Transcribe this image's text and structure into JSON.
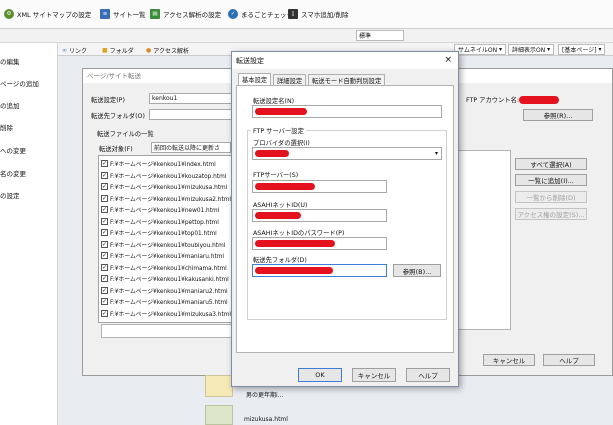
{
  "toolbar": {
    "items": [
      {
        "label": "XML サイトマップの設定",
        "icon": "gear-icon",
        "color": "#5a8f2c"
      },
      {
        "label": "サイト一覧",
        "icon": "list-icon",
        "color": "#3a6db5"
      },
      {
        "label": "アクセス解析の設定",
        "icon": "chart-icon",
        "color": "#3b8d3b"
      },
      {
        "label": "まるごとチェック",
        "icon": "check-icon",
        "color": "#2a6fb5"
      },
      {
        "label": "スマホ追加/削除",
        "icon": "phone-icon",
        "color": "#333333"
      }
    ],
    "mode_select": "標準"
  },
  "sidebar": {
    "items": [
      "の編集",
      "ページの追加",
      "の追加",
      "削除",
      "への変更",
      "名の変更",
      "の設定"
    ]
  },
  "tabs": {
    "items": [
      "リンク",
      "フォルダ",
      "アクセス解析"
    ],
    "thumbnail": "サムネイルON",
    "detail": "詳細表示ON",
    "basic": "[基本ページ]"
  },
  "background_dialog": {
    "title": "ページ/サイト転送",
    "transfer_setting_label": "転送設定(P)",
    "transfer_setting_value": "kenkou1",
    "transfer_folder_label": "転送先フォルダ(O)",
    "ftp_account_label": "FTP アカウント名:",
    "ref_button": "参照(R)...",
    "file_list_label": "転送ファイルの一覧",
    "transfer_target_label": "転送対象(F)",
    "transfer_target_value": "前回の転送以降に更新さ",
    "files": [
      "F:¥ホームページ¥kenkou1¥index.html",
      "F:¥ホームページ¥kenkou1¥kouzatop.html",
      "F:¥ホームページ¥kenkou1¥mizukusa.html",
      "F:¥ホームページ¥kenkou1¥mizukusa2.html",
      "F:¥ホームページ¥kenkou1¥new01.html",
      "F:¥ホームページ¥kenkou1¥pettop.html",
      "F:¥ホームページ¥kenkou1¥top01.html",
      "F:¥ホームページ¥kenkou1¥toubiyou.html",
      "F:¥ホームページ¥kenkou1¥maniaru.html",
      "F:¥ホームページ¥kenkou1¥chimama.html",
      "F:¥ホームページ¥kenkou1¥kakusanki.html",
      "F:¥ホームページ¥kenkou1¥maniaru2.html",
      "F:¥ホームページ¥kenkou1¥maniaru5.html",
      "F:¥ホームページ¥kenkou1¥mizukusa3.html"
    ],
    "select_all": "すべて選択(A)",
    "bulk_add": "一覧に追加(I)...",
    "bulk_remove": "一覧から削除(D)",
    "access_settings": "アクセス権の設定(S)...",
    "cancel": "キャンセル",
    "help": "ヘルプ"
  },
  "modal": {
    "title": "転送設定",
    "close": "×",
    "tabs": [
      "基本設定",
      "詳細設定",
      "転送モード自動判別設定"
    ],
    "transfer_name_label": "転送設定名(N)",
    "ftp_group_label": "FTP サーバー設定",
    "provider_label": "プロバイダの選択(I)",
    "ftp_server_label": "FTPサーバー(S)",
    "account_label": "ASAHIネットID(U)",
    "password_label": "ASAHIネットIDのパスワード(P)",
    "folder_label": "転送先フォルダ(D)",
    "ref_button": "参照(B)...",
    "ok": "OK",
    "cancel": "キャンセル",
    "help": "ヘルプ"
  },
  "preview": {
    "caption1": "男の更年期i...",
    "caption2": "mizukusa.html"
  },
  "colors": {
    "redact": "#e3121e",
    "accent": "#3b7dd8"
  }
}
